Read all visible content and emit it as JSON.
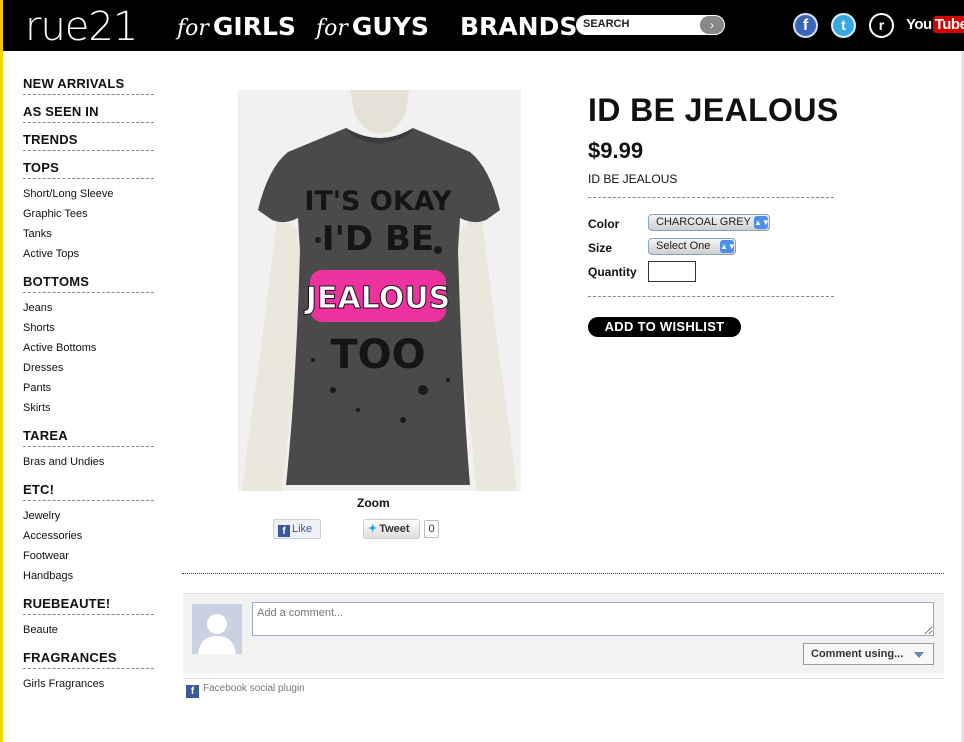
{
  "header": {
    "logo": "rue21",
    "nav": [
      {
        "prefix": "for",
        "label": "GIRLS"
      },
      {
        "prefix": "for",
        "label": "GUYS"
      },
      {
        "prefix": "",
        "label": "BRANDS"
      }
    ],
    "search_label": "SEARCH",
    "search_go": "›",
    "social": {
      "facebook": "f",
      "twitter": "t",
      "r": "r",
      "youtube_a": "You",
      "youtube_b": "Tube"
    },
    "icons": {
      "facebook": "facebook-icon",
      "twitter": "twitter-icon",
      "r": "r-logo-icon",
      "youtube": "youtube-icon"
    }
  },
  "sidebar": {
    "groups": [
      {
        "heading": "NEW ARRIVALS",
        "items": []
      },
      {
        "heading": "AS SEEN IN",
        "items": []
      },
      {
        "heading": "TRENDS",
        "items": []
      },
      {
        "heading": "TOPS",
        "items": [
          "Short/Long Sleeve",
          "Graphic Tees",
          "Tanks",
          "Active Tops"
        ]
      },
      {
        "heading": "BOTTOMS",
        "items": [
          "Jeans",
          "Shorts",
          "Active Bottoms",
          "Dresses",
          "Pants",
          "Skirts"
        ]
      },
      {
        "heading": "TAREA",
        "items": [
          "Bras and Undies"
        ]
      },
      {
        "heading": "ETC!",
        "items": [
          "Jewelry",
          "Accessories",
          "Footwear",
          "Handbags"
        ]
      },
      {
        "heading": "RUEBEAUTE!",
        "items": [
          "Beaute"
        ]
      },
      {
        "heading": "FRAGRANCES",
        "items": [
          "Girls Fragrances"
        ]
      }
    ]
  },
  "product": {
    "title": "ID BE JEALOUS",
    "price": "$9.99",
    "name": "ID BE JEALOUS",
    "color_label": "Color",
    "color_value": "CHARCOAL GREY",
    "size_label": "Size",
    "size_value": "Select One",
    "quantity_label": "Quantity",
    "quantity_value": "",
    "wishlist_label": "ADD TO WISHLIST",
    "zoom_label": "Zoom",
    "shirt_text": [
      "IT'S OKAY",
      "I'D BE",
      "JEALOUS",
      "TOO"
    ],
    "shirt_color": "#4a4a4a",
    "accent_pink": "#ff2fa8"
  },
  "share": {
    "like_label": "Like",
    "like_icon": "f",
    "tweet_label": "Tweet",
    "tweet_count": "0"
  },
  "comments": {
    "placeholder": "Add a comment...",
    "comment_using": "Comment using...",
    "plugin_label": "Facebook social plugin",
    "plugin_icon": "f"
  }
}
